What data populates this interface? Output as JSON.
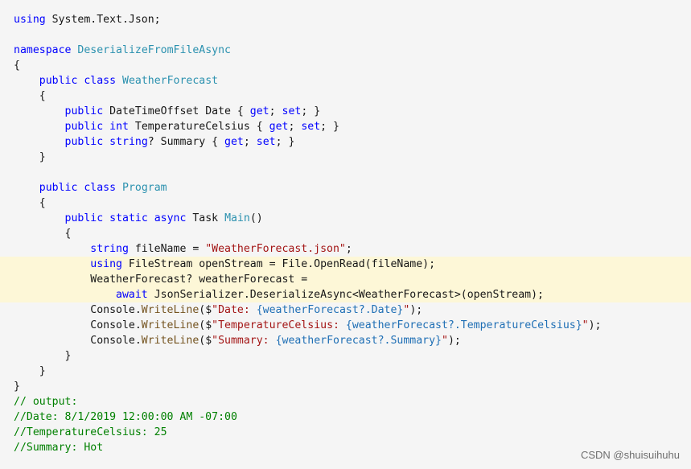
{
  "code": {
    "lines": [
      {
        "i": 0,
        "tokens": [
          [
            "kw",
            "using"
          ],
          [
            "ident",
            " System.Text.Json;"
          ]
        ]
      },
      {
        "i": 2,
        "tokens": [
          [
            "kw",
            "namespace"
          ],
          [
            "ident",
            " "
          ],
          [
            "type",
            "DeserializeFromFileAsync"
          ]
        ]
      },
      {
        "i": 3,
        "tokens": [
          [
            "ident",
            "{"
          ]
        ]
      },
      {
        "i": 4,
        "tokens": [
          [
            "ident",
            "    "
          ],
          [
            "kw",
            "public"
          ],
          [
            "ident",
            " "
          ],
          [
            "kw",
            "class"
          ],
          [
            "ident",
            " "
          ],
          [
            "type",
            "WeatherForecast"
          ]
        ]
      },
      {
        "i": 5,
        "tokens": [
          [
            "ident",
            "    {"
          ]
        ]
      },
      {
        "i": 6,
        "tokens": [
          [
            "ident",
            "        "
          ],
          [
            "kw",
            "public"
          ],
          [
            "ident",
            " DateTimeOffset Date { "
          ],
          [
            "kw",
            "get"
          ],
          [
            "ident",
            "; "
          ],
          [
            "kw",
            "set"
          ],
          [
            "ident",
            "; }"
          ]
        ]
      },
      {
        "i": 7,
        "tokens": [
          [
            "ident",
            "        "
          ],
          [
            "kw",
            "public"
          ],
          [
            "ident",
            " "
          ],
          [
            "kw",
            "int"
          ],
          [
            "ident",
            " TemperatureCelsius { "
          ],
          [
            "kw",
            "get"
          ],
          [
            "ident",
            "; "
          ],
          [
            "kw",
            "set"
          ],
          [
            "ident",
            "; }"
          ]
        ]
      },
      {
        "i": 8,
        "tokens": [
          [
            "ident",
            "        "
          ],
          [
            "kw",
            "public"
          ],
          [
            "ident",
            " "
          ],
          [
            "kw",
            "string"
          ],
          [
            "ident",
            "? Summary { "
          ],
          [
            "kw",
            "get"
          ],
          [
            "ident",
            "; "
          ],
          [
            "kw",
            "set"
          ],
          [
            "ident",
            "; }"
          ]
        ]
      },
      {
        "i": 9,
        "tokens": [
          [
            "ident",
            "    }"
          ]
        ]
      },
      {
        "i": 11,
        "tokens": [
          [
            "ident",
            "    "
          ],
          [
            "kw",
            "public"
          ],
          [
            "ident",
            " "
          ],
          [
            "kw",
            "class"
          ],
          [
            "ident",
            " "
          ],
          [
            "type",
            "Program"
          ]
        ]
      },
      {
        "i": 12,
        "tokens": [
          [
            "ident",
            "    {"
          ]
        ]
      },
      {
        "i": 13,
        "tokens": [
          [
            "ident",
            "        "
          ],
          [
            "kw",
            "public"
          ],
          [
            "ident",
            " "
          ],
          [
            "kw",
            "static"
          ],
          [
            "ident",
            " "
          ],
          [
            "kw",
            "async"
          ],
          [
            "ident",
            " Task "
          ],
          [
            "type",
            "Main"
          ],
          [
            "ident",
            "()"
          ]
        ]
      },
      {
        "i": 14,
        "tokens": [
          [
            "ident",
            "        {"
          ]
        ]
      },
      {
        "i": 15,
        "tokens": [
          [
            "ident",
            "            "
          ],
          [
            "kw",
            "string"
          ],
          [
            "ident",
            " fileName = "
          ],
          [
            "str",
            "\"WeatherForecast.json\""
          ],
          [
            "ident",
            ";"
          ]
        ]
      },
      {
        "i": 16,
        "hl": true,
        "tokens": [
          [
            "ident",
            "            "
          ],
          [
            "kw",
            "using"
          ],
          [
            "ident",
            " FileStream openStream = File.OpenRead(fileName);"
          ]
        ]
      },
      {
        "i": 17,
        "hl": true,
        "tokens": [
          [
            "ident",
            "            WeatherForecast? weatherForecast ="
          ]
        ]
      },
      {
        "i": 18,
        "hl": true,
        "tokens": [
          [
            "ident",
            "                "
          ],
          [
            "kw",
            "await"
          ],
          [
            "ident",
            " JsonSerializer.DeserializeAsync<WeatherForecast>(openStream);"
          ]
        ]
      },
      {
        "i": 19,
        "tokens": [
          [
            "ident",
            "            Console."
          ],
          [
            "method",
            "WriteLine"
          ],
          [
            "ident",
            "($"
          ],
          [
            "str",
            "\"Date: "
          ],
          [
            "interp",
            "{weatherForecast?.Date}"
          ],
          [
            "str",
            "\""
          ],
          [
            "ident",
            ");"
          ]
        ]
      },
      {
        "i": 20,
        "tokens": [
          [
            "ident",
            "            Console."
          ],
          [
            "method",
            "WriteLine"
          ],
          [
            "ident",
            "($"
          ],
          [
            "str",
            "\"TemperatureCelsius: "
          ],
          [
            "interp",
            "{weatherForecast?.TemperatureCelsius}"
          ],
          [
            "str",
            "\""
          ],
          [
            "ident",
            ");"
          ]
        ]
      },
      {
        "i": 21,
        "tokens": [
          [
            "ident",
            "            Console."
          ],
          [
            "method",
            "WriteLine"
          ],
          [
            "ident",
            "($"
          ],
          [
            "str",
            "\"Summary: "
          ],
          [
            "interp",
            "{weatherForecast?.Summary}"
          ],
          [
            "str",
            "\""
          ],
          [
            "ident",
            ");"
          ]
        ]
      },
      {
        "i": 22,
        "tokens": [
          [
            "ident",
            "        }"
          ]
        ]
      },
      {
        "i": 23,
        "tokens": [
          [
            "ident",
            "    }"
          ]
        ]
      },
      {
        "i": 24,
        "tokens": [
          [
            "ident",
            "}"
          ]
        ]
      },
      {
        "i": 25,
        "tokens": [
          [
            "comment",
            "// output:"
          ]
        ]
      },
      {
        "i": 26,
        "tokens": [
          [
            "comment",
            "//Date: 8/1/2019 12:00:00 AM -07:00"
          ]
        ]
      },
      {
        "i": 27,
        "tokens": [
          [
            "comment",
            "//TemperatureCelsius: 25"
          ]
        ]
      },
      {
        "i": 28,
        "tokens": [
          [
            "comment",
            "//Summary: Hot"
          ]
        ]
      }
    ]
  },
  "watermark": "CSDN @shuisuihuhu"
}
